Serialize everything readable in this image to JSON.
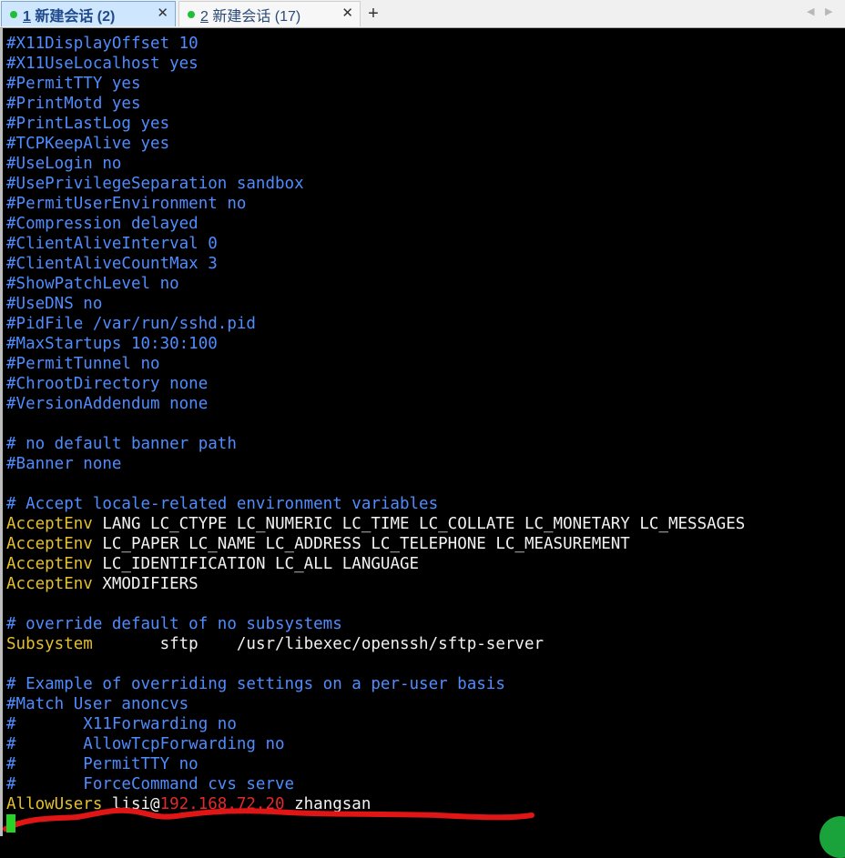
{
  "tabs": [
    {
      "num": "1",
      "title": "新建会话 (2)",
      "active": true,
      "status_color": "#1fbf3a"
    },
    {
      "num": "2",
      "title": "新建会话 (17)",
      "active": false,
      "status_color": "#1fbf3a"
    }
  ],
  "tab_close_glyph": "✕",
  "new_tab_glyph": "+",
  "nav_prev_glyph": "◀",
  "nav_next_glyph": "▶",
  "terminal": {
    "lines": [
      [
        {
          "t": "#X11DisplayOffset 10",
          "s": "c"
        }
      ],
      [
        {
          "t": "#X11UseLocalhost yes",
          "s": "c"
        }
      ],
      [
        {
          "t": "#PermitTTY yes",
          "s": "c"
        }
      ],
      [
        {
          "t": "#PrintMotd yes",
          "s": "c"
        }
      ],
      [
        {
          "t": "#PrintLastLog yes",
          "s": "c"
        }
      ],
      [
        {
          "t": "#TCPKeepAlive yes",
          "s": "c"
        }
      ],
      [
        {
          "t": "#UseLogin no",
          "s": "c"
        }
      ],
      [
        {
          "t": "#UsePrivilegeSeparation sandbox",
          "s": "c"
        }
      ],
      [
        {
          "t": "#PermitUserEnvironment no",
          "s": "c"
        }
      ],
      [
        {
          "t": "#Compression delayed",
          "s": "c"
        }
      ],
      [
        {
          "t": "#ClientAliveInterval 0",
          "s": "c"
        }
      ],
      [
        {
          "t": "#ClientAliveCountMax 3",
          "s": "c"
        }
      ],
      [
        {
          "t": "#ShowPatchLevel no",
          "s": "c"
        }
      ],
      [
        {
          "t": "#UseDNS no",
          "s": "c"
        }
      ],
      [
        {
          "t": "#PidFile /var/run/sshd.pid",
          "s": "c"
        }
      ],
      [
        {
          "t": "#MaxStartups 10:30:100",
          "s": "c"
        }
      ],
      [
        {
          "t": "#PermitTunnel no",
          "s": "c"
        }
      ],
      [
        {
          "t": "#ChrootDirectory none",
          "s": "c"
        }
      ],
      [
        {
          "t": "#VersionAddendum none",
          "s": "c"
        }
      ],
      [],
      [
        {
          "t": "# no default banner path",
          "s": "c"
        }
      ],
      [
        {
          "t": "#Banner none",
          "s": "c"
        }
      ],
      [],
      [
        {
          "t": "# Accept locale-related environment variables",
          "s": "c"
        }
      ],
      [
        {
          "t": "AcceptEnv",
          "s": "k"
        },
        {
          "t": " LANG LC_CTYPE LC_NUMERIC LC_TIME LC_COLLATE LC_MONETARY LC_MESSAGES",
          "s": "v"
        }
      ],
      [
        {
          "t": "AcceptEnv",
          "s": "k"
        },
        {
          "t": " LC_PAPER LC_NAME LC_ADDRESS LC_TELEPHONE LC_MEASUREMENT",
          "s": "v"
        }
      ],
      [
        {
          "t": "AcceptEnv",
          "s": "k"
        },
        {
          "t": " LC_IDENTIFICATION LC_ALL LANGUAGE",
          "s": "v"
        }
      ],
      [
        {
          "t": "AcceptEnv",
          "s": "k"
        },
        {
          "t": " XMODIFIERS",
          "s": "v"
        }
      ],
      [],
      [
        {
          "t": "# override default of no subsystems",
          "s": "c"
        }
      ],
      [
        {
          "t": "Subsystem",
          "s": "k"
        },
        {
          "t": "       sftp    /usr/libexec/openssh/sftp-server",
          "s": "v"
        }
      ],
      [],
      [
        {
          "t": "# Example of overriding settings on a per-user basis",
          "s": "c"
        }
      ],
      [
        {
          "t": "#Match User anoncvs",
          "s": "c"
        }
      ],
      [
        {
          "t": "#       X11Forwarding no",
          "s": "c"
        }
      ],
      [
        {
          "t": "#       AllowTcpForwarding no",
          "s": "c"
        }
      ],
      [
        {
          "t": "#       PermitTTY no",
          "s": "c"
        }
      ],
      [
        {
          "t": "#       ForceCommand cvs serve",
          "s": "c"
        }
      ],
      [
        {
          "t": "AllowUsers",
          "s": "k"
        },
        {
          "t": " lisi@",
          "s": "v"
        },
        {
          "t": "192.168.72.20",
          "s": "ip"
        },
        {
          "t": " zhangsan",
          "s": "v"
        }
      ]
    ]
  },
  "colors": {
    "comment": "#4f8cff",
    "keyword": "#e6c02a",
    "value": "#f2f2f2",
    "ip_highlight": "#e22a2a",
    "cursor": "#26d426",
    "annotation_scribble": "#e01515"
  }
}
